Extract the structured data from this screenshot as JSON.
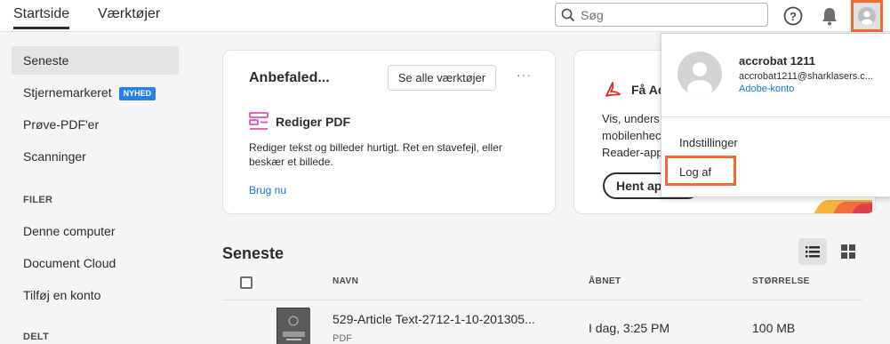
{
  "header": {
    "tabs": [
      "Startside",
      "Værktøjer"
    ],
    "search_placeholder": "Søg",
    "icons": [
      "search-icon",
      "help-icon",
      "bell-icon",
      "avatar-icon"
    ]
  },
  "sidebar": {
    "items": [
      {
        "label": "Seneste"
      },
      {
        "label": "Stjernemarkeret",
        "badge": "NYHED"
      },
      {
        "label": "Prøve-PDF'er"
      },
      {
        "label": "Scanninger"
      }
    ],
    "files_heading": "FILER",
    "files_items": [
      "Denne computer",
      "Document Cloud",
      "Tilføj en konto"
    ],
    "shared_heading": "DELT"
  },
  "card_recommended": {
    "title": "Anbefaled...",
    "see_all": "Se alle værktøjer",
    "more": "···",
    "tool_name": "Rediger PDF",
    "tool_desc": "Rediger tekst og billeder hurtigt. Ret en stavefejl, eller beskær et billede.",
    "tool_link": "Brug nu"
  },
  "card_app": {
    "title": "Få Ac",
    "desc": "Vis, unders\nmobilenhec\nReader-app",
    "button": "Hent ap"
  },
  "recent": {
    "title": "Seneste",
    "columns": [
      "NAVN",
      "ÅBNET",
      "STØRRELSE"
    ],
    "rows": [
      {
        "name": "529-Article Text-2712-1-10-201305...",
        "type": "PDF",
        "opened": "I dag, 3:25 PM",
        "size": "100 MB"
      }
    ]
  },
  "account_menu": {
    "name": "accrobat 1211",
    "email": "accrobat1211@sharklasers.c...",
    "account_link": "Adobe-konto",
    "items": [
      "Indstillinger",
      "Log af"
    ]
  },
  "colors": {
    "accent": "#1473e6",
    "highlight": "#f26a2e",
    "badge": "#2680eb"
  }
}
